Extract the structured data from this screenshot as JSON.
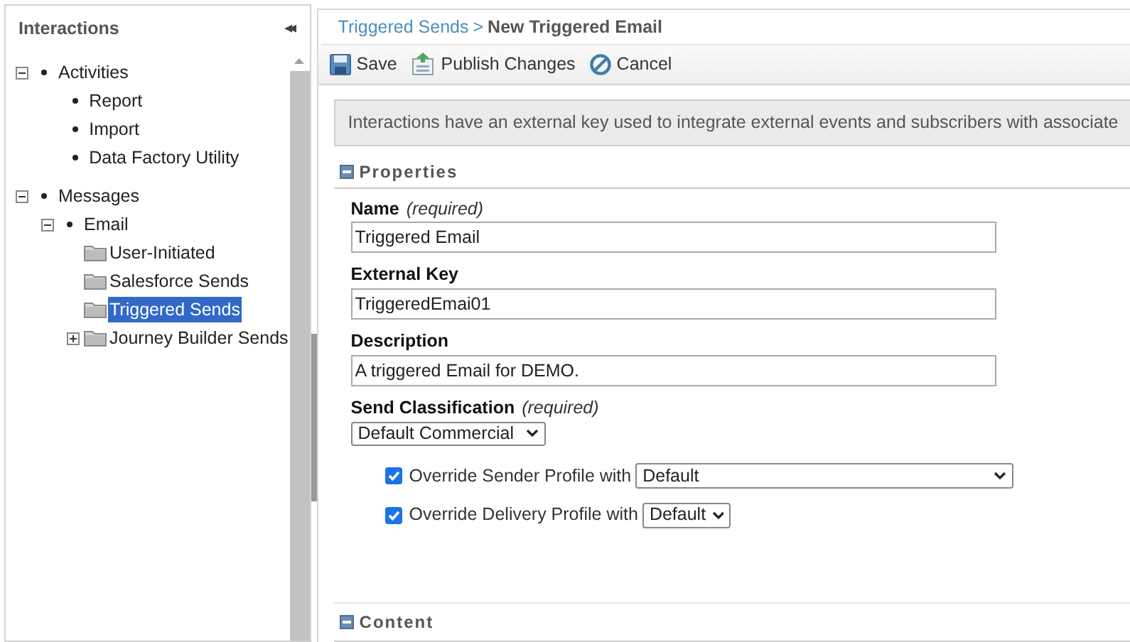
{
  "sidebar": {
    "title": "Interactions",
    "collapse": "◂◂",
    "tree": [
      {
        "label": "Activities",
        "kind": "bullet",
        "expanded": true,
        "selected": false,
        "children": [
          {
            "label": "Report",
            "kind": "bullet",
            "selected": false
          },
          {
            "label": "Import",
            "kind": "bullet",
            "selected": false
          },
          {
            "label": "Data Factory Utility",
            "kind": "bullet",
            "selected": false
          }
        ]
      },
      {
        "label": "Messages",
        "kind": "bullet",
        "expanded": true,
        "selected": false,
        "children": [
          {
            "label": "Email",
            "kind": "bullet",
            "expanded": true,
            "selected": false,
            "children": [
              {
                "label": "User-Initiated",
                "kind": "folder",
                "selected": false
              },
              {
                "label": "Salesforce Sends",
                "kind": "folder",
                "selected": false
              },
              {
                "label": "Triggered Sends",
                "kind": "folder",
                "selected": true
              },
              {
                "label": "Journey Builder Sends",
                "kind": "folder",
                "expanded": false,
                "selected": false
              }
            ]
          }
        ]
      }
    ]
  },
  "breadcrumb": {
    "link": "Triggered Sends",
    "separator": ">",
    "current": "New Triggered Email"
  },
  "toolbar": [
    {
      "label": "Save",
      "kind": "save"
    },
    {
      "label": "Publish Changes",
      "kind": "publish"
    },
    {
      "label": "Cancel",
      "kind": "cancel"
    }
  ],
  "info": "Interactions have an external key used to integrate external events and subscribers with associate",
  "sections": [
    {
      "title": "Properties",
      "expanded": true
    },
    {
      "title": "Content",
      "expanded": true
    }
  ],
  "fields": [
    {
      "label": "Name",
      "note": "(required)",
      "value": "Triggered Email"
    },
    {
      "label": "External Key",
      "value": "TriggeredEmai01"
    },
    {
      "label": "Description",
      "value": "A triggered Email for DEMO."
    }
  ],
  "classification": {
    "label": "Send Classification",
    "note": "(required)",
    "value": "Default Commercial"
  },
  "overrides": [
    {
      "label": "Override Sender Profile with",
      "checked": true,
      "value": "Default"
    },
    {
      "label": "Override Delivery Profile with",
      "checked": true,
      "value": "Default"
    }
  ]
}
